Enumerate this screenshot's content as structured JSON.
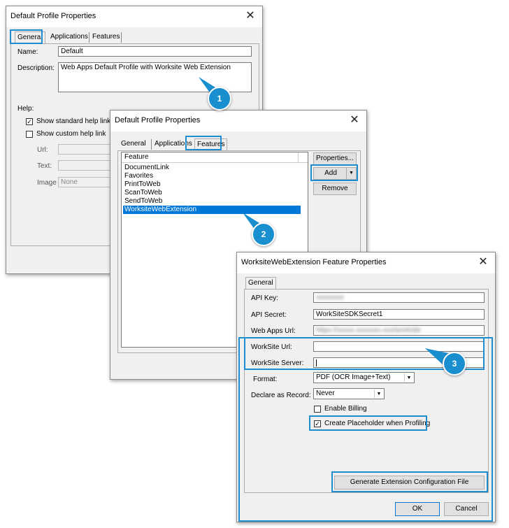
{
  "dialog1": {
    "title": "Default Profile Properties",
    "close_glyph": "✕",
    "tabs": [
      "General",
      "Applications",
      "Features"
    ],
    "name_label": "Name:",
    "name_value": "Default",
    "description_label": "Description:",
    "description_value": "Web Apps Default Profile with Worksite Web Extension",
    "help_label": "Help:",
    "show_standard_help": "Show standard help link",
    "show_custom_help": "Show custom help link",
    "url_label": "Url:",
    "text_label": "Text:",
    "image_label": "Image",
    "image_value": "None"
  },
  "dialog2": {
    "title": "Default Profile Properties",
    "close_glyph": "✕",
    "tabs": [
      "General",
      "Applications",
      "Features"
    ],
    "list_header": "Feature",
    "features": [
      "DocumentLink",
      "Favorites",
      "PrintToWeb",
      "ScanToWeb",
      "SendToWeb",
      "WorksiteWebExtension"
    ],
    "selected_feature_index": 5,
    "properties_button": "Properties...",
    "add_button": "Add",
    "remove_button": "Remove"
  },
  "dialog3": {
    "title": "WorksiteWebExtension Feature Properties",
    "close_glyph": "✕",
    "tab": "General",
    "api_key_label": "API Key:",
    "api_key_value": "xxxxxxxx",
    "api_secret_label": "API Secret:",
    "api_secret_value": "WorkSiteSDKSecret1",
    "web_apps_url_label": "Web Apps Url:",
    "web_apps_url_value": "https://xxxxx.xxxxxxx.xxx/worksite",
    "worksite_url_label": "WorkSite Url:",
    "worksite_url_value": "",
    "worksite_server_label": "WorkSite Server:",
    "worksite_server_value": "",
    "format_label": "Format:",
    "format_value": "PDF (OCR Image+Text)",
    "declare_label": "Declare as Record:",
    "declare_value": "Never",
    "enable_billing": "Enable Billing",
    "create_placeholder": "Create Placeholder when Profiling",
    "generate_button": "Generate Extension Configuration File",
    "ok_button": "OK",
    "cancel_button": "Cancel"
  },
  "callouts": [
    "1",
    "2",
    "3"
  ],
  "colors": {
    "highlight": "#1f8ccf",
    "callout": "#1a8fcf",
    "selection": "#0078d7"
  }
}
